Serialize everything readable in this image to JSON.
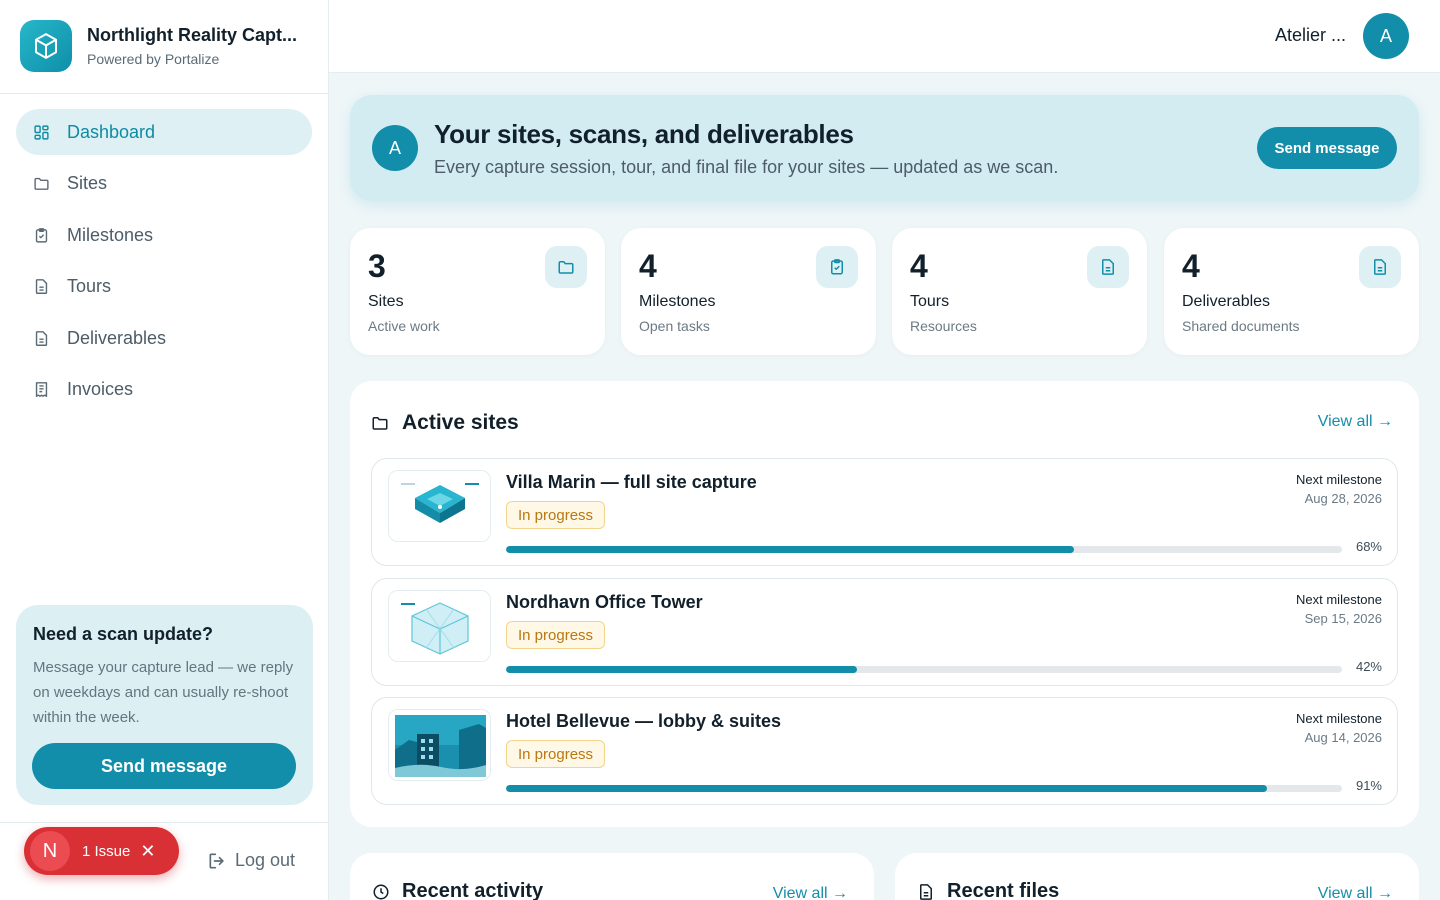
{
  "brand": {
    "name": "Northlight Reality Capt...",
    "powered_by": "Powered by Portalize"
  },
  "user": {
    "name": "Atelier ...",
    "initial": "A"
  },
  "sidebar": {
    "items": [
      {
        "label": "Dashboard",
        "icon": "grid-icon",
        "active": true
      },
      {
        "label": "Sites",
        "icon": "folder-icon"
      },
      {
        "label": "Milestones",
        "icon": "clipboard-check-icon"
      },
      {
        "label": "Tours",
        "icon": "document-icon"
      },
      {
        "label": "Deliverables",
        "icon": "document-icon"
      },
      {
        "label": "Invoices",
        "icon": "receipt-icon"
      }
    ],
    "help": {
      "title": "Need a scan update?",
      "body": "Message your capture lead — we reply on weekdays and can usually re-shoot within the week.",
      "button": "Send message"
    },
    "logout": "Log out"
  },
  "issue_badge": {
    "initial": "N",
    "label": "1 Issue"
  },
  "hero": {
    "initial": "A",
    "title": "Your sites, scans, and deliverables",
    "subtitle": "Every capture session, tour, and final file for your sites — updated as we scan.",
    "button": "Send message"
  },
  "stats": [
    {
      "value": "3",
      "label": "Sites",
      "sub": "Active work",
      "icon": "folder-icon"
    },
    {
      "value": "4",
      "label": "Milestones",
      "sub": "Open tasks",
      "icon": "clipboard-check-icon"
    },
    {
      "value": "4",
      "label": "Tours",
      "sub": "Resources",
      "icon": "document-icon"
    },
    {
      "value": "4",
      "label": "Deliverables",
      "sub": "Shared documents",
      "icon": "document-icon"
    }
  ],
  "active_sites": {
    "title": "Active sites",
    "view_all": "View all →",
    "milestone_label": "Next milestone",
    "sites": [
      {
        "name": "Villa Marin — full site capture",
        "status": "In progress",
        "next_milestone": "Aug 28, 2026",
        "progress": 68,
        "progress_label": "68%"
      },
      {
        "name": "Nordhavn Office Tower",
        "status": "In progress",
        "next_milestone": "Sep 15, 2026",
        "progress": 42,
        "progress_label": "42%"
      },
      {
        "name": "Hotel Bellevue — lobby & suites",
        "status": "In progress",
        "next_milestone": "Aug 14, 2026",
        "progress": 91,
        "progress_label": "91%"
      }
    ]
  },
  "recent_activity": {
    "title": "Recent activity",
    "view_all": "View all →"
  },
  "recent_files": {
    "title": "Recent files",
    "view_all": "View all →"
  },
  "colors": {
    "accent": "#138eaa",
    "accent_light": "#def0f4",
    "issue_red": "#d93036",
    "badge_bg": "#fff8e6",
    "badge_text": "#b87810"
  }
}
